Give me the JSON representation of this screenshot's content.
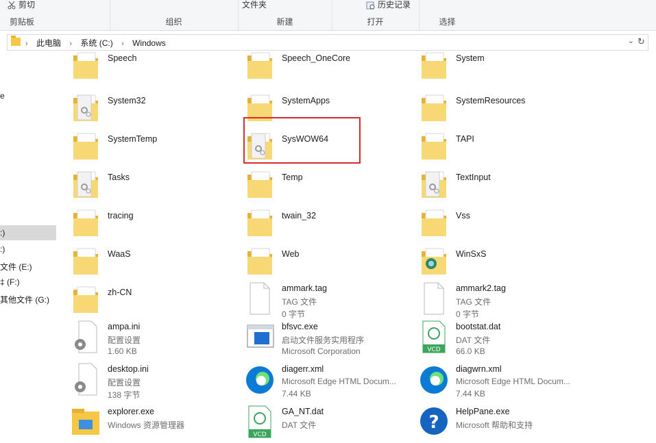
{
  "ribbon": {
    "cut": "剪切",
    "clipboard": "剪贴板",
    "organize": "组织",
    "folder": "文件夹",
    "new": "新建",
    "history": "历史记录",
    "open": "打开",
    "select": "选择"
  },
  "address": {
    "crumbs": [
      "此电脑",
      "系统 (C:)",
      "Windows"
    ],
    "dropdown_icon": "chevron-down-icon",
    "refresh_icon": "refresh-icon"
  },
  "nav": {
    "items": [
      "e",
      ":)",
      ":)",
      "文件 (E:)",
      "‡ (F:)",
      "其他文件 (G:)"
    ]
  },
  "files": [
    {
      "name": "Speech",
      "type": "folder"
    },
    {
      "name": "Speech_OneCore",
      "type": "folder"
    },
    {
      "name": "System",
      "type": "folder"
    },
    {
      "name": "System32",
      "type": "folder-gear"
    },
    {
      "name": "SystemApps",
      "type": "folder"
    },
    {
      "name": "SystemResources",
      "type": "folder"
    },
    {
      "name": "SystemTemp",
      "type": "folder"
    },
    {
      "name": "SysWOW64",
      "type": "folder-gear"
    },
    {
      "name": "TAPI",
      "type": "folder"
    },
    {
      "name": "Tasks",
      "type": "folder-gear"
    },
    {
      "name": "Temp",
      "type": "folder"
    },
    {
      "name": "TextInput",
      "type": "folder-gear"
    },
    {
      "name": "tracing",
      "type": "folder"
    },
    {
      "name": "twain_32",
      "type": "folder"
    },
    {
      "name": "Vss",
      "type": "folder"
    },
    {
      "name": "WaaS",
      "type": "folder"
    },
    {
      "name": "Web",
      "type": "folder"
    },
    {
      "name": "WinSxS",
      "type": "folder-special"
    },
    {
      "name": "zh-CN",
      "type": "folder"
    },
    {
      "name": "ammark.tag",
      "line2": "TAG 文件",
      "line3": "0 字节",
      "type": "blank-file"
    },
    {
      "name": "ammark2.tag",
      "line2": "TAG 文件",
      "line3": "0 字节",
      "type": "blank-file"
    },
    {
      "name": "ampa.ini",
      "line2": "配置设置",
      "line3": "1.60 KB",
      "type": "ini-file"
    },
    {
      "name": "bfsvc.exe",
      "line2": "启动文件服务实用程序",
      "line3": "Microsoft Corporation",
      "type": "exe-window"
    },
    {
      "name": "bootstat.dat",
      "line2": "DAT 文件",
      "line3": "66.0 KB",
      "type": "vcd-file"
    },
    {
      "name": "desktop.ini",
      "line2": "配置设置",
      "line3": "138 字节",
      "type": "ini-file"
    },
    {
      "name": "diagerr.xml",
      "line2": "Microsoft Edge HTML Docum...",
      "line3": "7.44 KB",
      "type": "edge-file"
    },
    {
      "name": "diagwrn.xml",
      "line2": "Microsoft Edge HTML Docum...",
      "line3": "7.44 KB",
      "type": "edge-file"
    },
    {
      "name": "explorer.exe",
      "line2": "Windows 资源管理器",
      "line3": "",
      "type": "explorer"
    },
    {
      "name": "GA_NT.dat",
      "line2": "DAT 文件",
      "line3": "",
      "type": "vcd-file"
    },
    {
      "name": "HelpPane.exe",
      "line2": "Microsoft 帮助和支持",
      "line3": "",
      "type": "help"
    }
  ],
  "colors": {
    "folder": "#f6c744",
    "highlight": "#d92b2b",
    "selection": "#d9d9d9"
  }
}
